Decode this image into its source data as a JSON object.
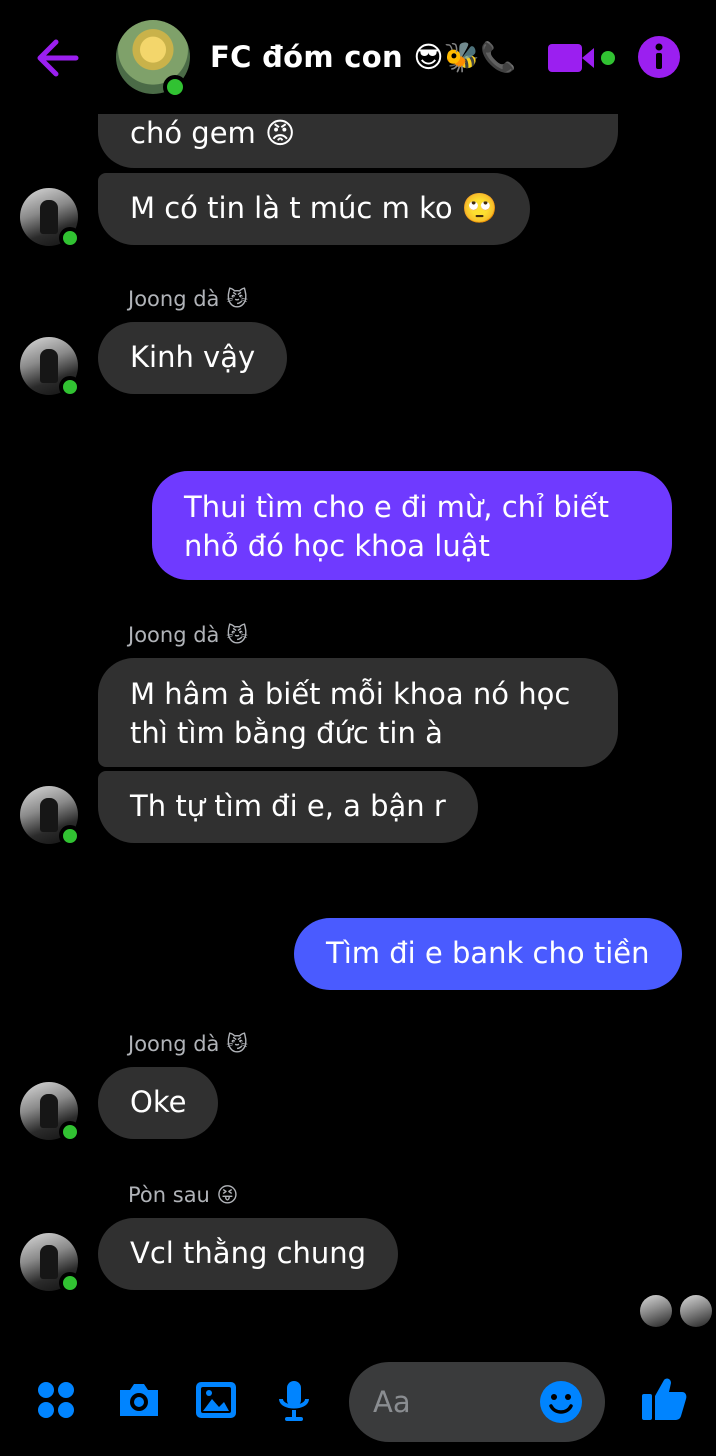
{
  "header": {
    "title": "FC đóm con 😎🐝📞",
    "back_icon": "arrow-left-icon",
    "video_icon": "video-camera-icon",
    "info_icon": "info-icon",
    "accent_color": "#9b1ff0"
  },
  "messages": [
    {
      "id": "m1",
      "text": "chó gem 😡",
      "from": "other"
    },
    {
      "id": "m2",
      "text": "M có tin là t múc m ko 🙄",
      "from": "other"
    },
    {
      "id": "s1",
      "sender": "Joong dà 😼"
    },
    {
      "id": "m3",
      "text": "Kinh vậy",
      "from": "other"
    },
    {
      "id": "m4",
      "text": "Thui tìm cho e đi mừ, chỉ biết nhỏ đó học khoa luật",
      "from": "me"
    },
    {
      "id": "s2",
      "sender": "Joong dà 😼"
    },
    {
      "id": "m5",
      "text": "M hâm à biết mỗi khoa nó học thì tìm bằng đức tin à",
      "from": "other"
    },
    {
      "id": "m6",
      "text": "Th tự tìm đi e, a bận r",
      "from": "other"
    },
    {
      "id": "m7",
      "text": "Tìm đi e bank cho tiền",
      "from": "me"
    },
    {
      "id": "s3",
      "sender": "Joong dà 😼"
    },
    {
      "id": "m8",
      "text": "Oke",
      "from": "other"
    },
    {
      "id": "s4",
      "sender": "Pòn sau 😝"
    },
    {
      "id": "m9",
      "text": "Vcl thằng chung",
      "from": "other"
    }
  ],
  "composer": {
    "placeholder": "Aa",
    "icons": [
      "menu-dots-icon",
      "camera-icon",
      "image-icon",
      "microphone-icon",
      "emoji-icon",
      "like-icon"
    ],
    "icon_color": "#0084ff"
  }
}
